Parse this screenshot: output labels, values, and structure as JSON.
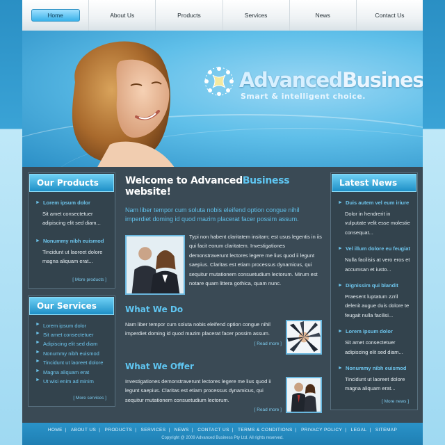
{
  "nav": {
    "items": [
      {
        "label": "Home",
        "active": true
      },
      {
        "label": "About Us"
      },
      {
        "label": "Products"
      },
      {
        "label": "Services"
      },
      {
        "label": "News"
      },
      {
        "label": "Contact Us"
      }
    ]
  },
  "banner": {
    "logo_part1": "Advanced",
    "logo_part2": "Business",
    "tagline": "Smart & intelligent choice."
  },
  "products": {
    "title": "Our Products",
    "entries": [
      {
        "head": "Lorem ipsum dolor",
        "body": "Sit amet consectetuer adipiscing elit sed diam..."
      },
      {
        "head": "Nonummy nibh euismod",
        "body": "Tincidunt ut laoreet dolore magna aliquam erat..."
      }
    ],
    "more": "[  More products  ]"
  },
  "services": {
    "title": "Our Services",
    "items": [
      "Lorem ipsum dolor",
      "Sit amet consectetuer",
      "Adipiscing elit sed diam",
      "Nonummy nibh euismod",
      "Tincidunt ut laoreet dolore",
      "Magna aliquam erat",
      "Ut wisi enim ad minim"
    ],
    "more": "[  More services  ]"
  },
  "main": {
    "welcome_a": "Welcome to Advanced",
    "welcome_b": "Business",
    "welcome_c": " website!",
    "intro": "Nam liber tempor cum soluta nobis eleifend option congue nihil imperdiet doming id quod mazim placerat facer possim assum.",
    "feature_text": "Typi non habent claritatem insitam; est usus legentis in iis qui facit eorum claritatem. Investigationes demonstraverunt lectores legere me lius quod ii legunt saepius. Claritas est etiam processus dynamicus, qui sequitur mutationem consuetudium lectorum. Mirum est notare quam littera gothica, quam nunc.",
    "what_we_do_title": "What We Do",
    "what_we_do_text": "Nam liber tempor cum soluta nobis eleifend option congue nihil imperdiet doming id quod mazim placerat facer possim assum.",
    "what_we_offer_title": "What We Offer",
    "what_we_offer_text": "Investigationes demonstraverunt lectores legere me lius quod ii legunt saepius. Claritas est etiam processus dynamicus, qui sequitur mutationem consuetudium lectorum.",
    "read_more": "[  Read more  ]"
  },
  "news": {
    "title": "Latest News",
    "entries": [
      {
        "head": "Duis autem vel eum iriure",
        "body": "Dolor in hendrerit in vulputate velit esse molestie consequat..."
      },
      {
        "head": "Vel illum dolore eu feugiat",
        "body": "Nulla facilisis at vero eros et accumsan et iusto..."
      },
      {
        "head": "Dignissim qui blandit",
        "body": "Praesent luptatum zzril delenit augue duis dolore te feugait nulla facilisi..."
      },
      {
        "head": "Lorem ipsum dolor",
        "body": "Sit amet consectetuer adipiscing elit sed diam..."
      },
      {
        "head": "Nonummy nibh euismod",
        "body": "Tincidunt ut laoreet dolore magna aliquam erat..."
      }
    ],
    "more": "[  More news  ]"
  },
  "footer": {
    "links": [
      "HOME",
      "ABOUT US",
      "PRODUCTS",
      "SERVICES",
      "NEWS",
      "CONTACT US",
      "TERMS & CONDITIONS",
      "PRIVACY POLICY",
      "LEGAL",
      "SITEMAP"
    ],
    "copyright": "Copyright @ 2009 Advanced Business Pty Ltd. All rights reserved."
  },
  "colors": {
    "accent": "#5fc6f2",
    "panel": "#3a4a55",
    "nav_active": "#3ab2ea"
  }
}
